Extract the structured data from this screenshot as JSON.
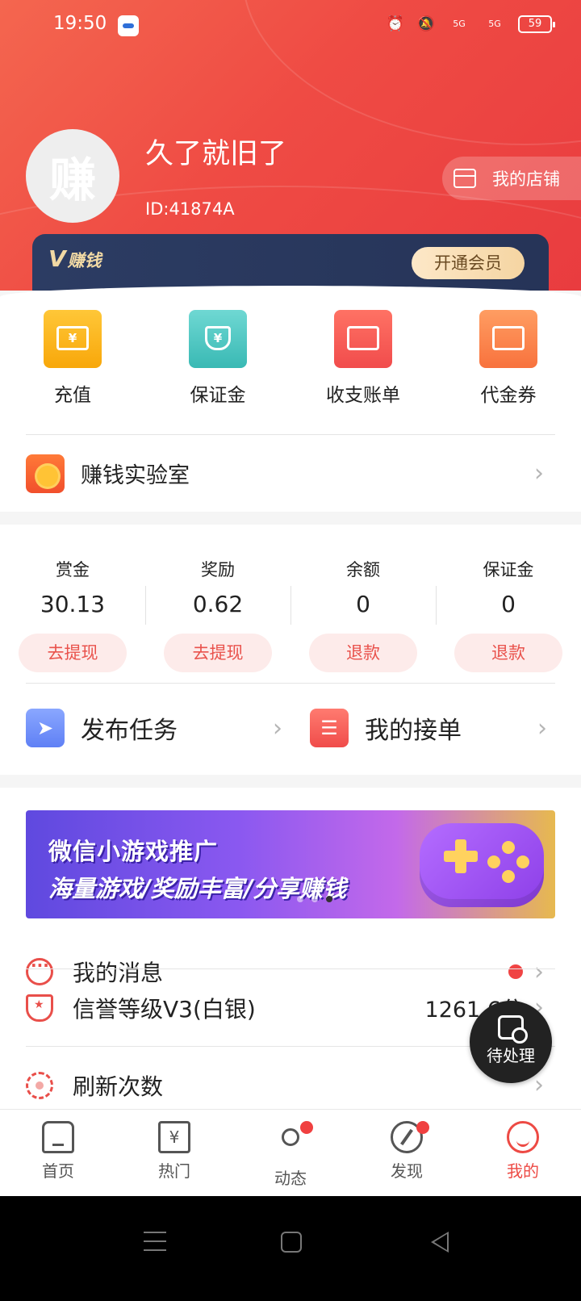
{
  "status_bar": {
    "time": "19:50",
    "battery": "59",
    "signal_1": "5G",
    "signal_2": "5G"
  },
  "profile": {
    "avatar_char": "赚",
    "username": "久了就旧了",
    "user_id": "ID:41874A",
    "shop_label": "我的店铺"
  },
  "vip": {
    "logo_v": "V",
    "logo_text": "赚钱",
    "button_label": "开通会员"
  },
  "quick_actions": [
    {
      "label": "充值",
      "icon": "recharge-icon",
      "glyph": "¥"
    },
    {
      "label": "保证金",
      "icon": "deposit-shield-icon",
      "glyph": "¥"
    },
    {
      "label": "收支账单",
      "icon": "wallet-icon",
      "glyph": ""
    },
    {
      "label": "代金券",
      "icon": "voucher-icon",
      "glyph": ""
    }
  ],
  "lab": {
    "label": "赚钱实验室"
  },
  "balances": [
    {
      "title": "赏金",
      "value": "30.13",
      "action": "去提现"
    },
    {
      "title": "奖励",
      "value": "0.62",
      "action": "去提现"
    },
    {
      "title": "余额",
      "value": "0",
      "action": "退款"
    },
    {
      "title": "保证金",
      "value": "0",
      "action": "退款"
    }
  ],
  "tasks": {
    "publish_label": "发布任务",
    "orders_label": "我的接单"
  },
  "banner": {
    "line1": "微信小游戏推广",
    "line2": "海量游戏/奖励丰富/分享赚钱"
  },
  "list": {
    "messages_label": "我的消息",
    "credit_label": "信誉等级V3(白银)",
    "credit_value": "1261.6分",
    "refresh_label": "刷新次数"
  },
  "pending": {
    "label": "待处理"
  },
  "tabs": [
    {
      "label": "首页",
      "glyph": ""
    },
    {
      "label": "热门",
      "glyph": "¥"
    },
    {
      "label": "动态",
      "glyph": ""
    },
    {
      "label": "发现",
      "glyph": ""
    },
    {
      "label": "我的",
      "glyph": ""
    }
  ],
  "colors": {
    "accent": "#ed4a44",
    "vip_bg": "#263458",
    "vip_gold": "#f1d9a4"
  }
}
